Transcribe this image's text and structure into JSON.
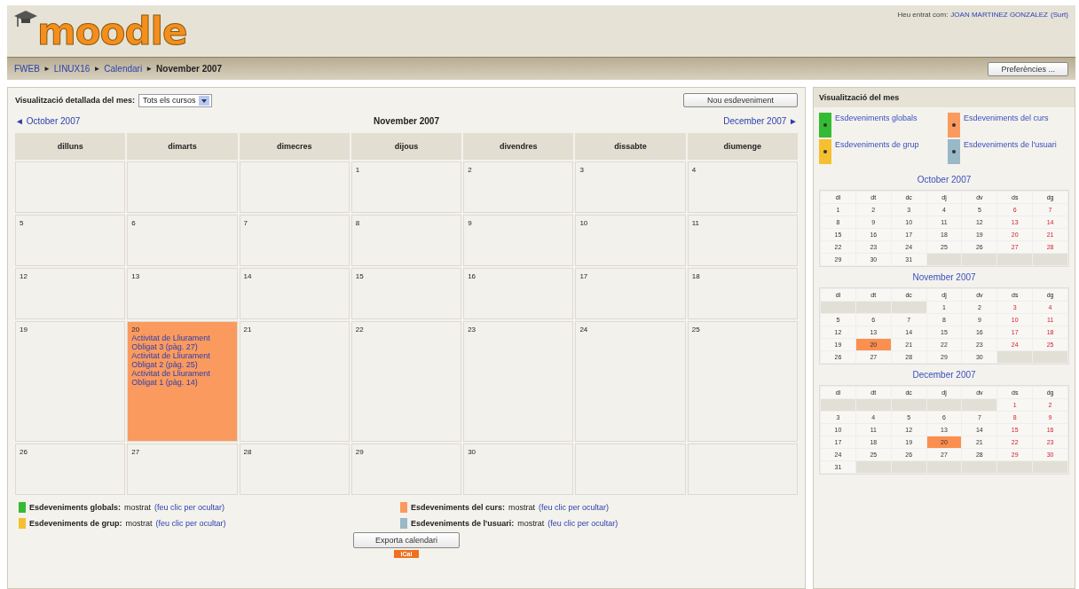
{
  "header": {
    "logo": "moodle",
    "login_prefix": "Heu entrat com:",
    "login_user": "JOAN MARTINEZ GONZALEZ",
    "logout": "(Surt)"
  },
  "breadcrumb": [
    {
      "label": "FWEB",
      "link": true
    },
    {
      "prefix": "►",
      "label": "LINUX16",
      "link": true
    },
    {
      "prefix": "►",
      "label": "Calendari",
      "link": true
    },
    {
      "prefix": "►",
      "label": "November 2007",
      "link": false
    }
  ],
  "preferences_button": "Preferències ...",
  "main": {
    "view_label": "Visualització detallada del mes:",
    "course_select": "Tots els cursos",
    "new_event_button": "Nou esdeveniment",
    "prev_month": "◄ October 2007",
    "month_title": "November 2007",
    "next_month": "December 2007 ►",
    "weekdays": [
      "dilluns",
      "dimarts",
      "dimecres",
      "dijous",
      "divendres",
      "dissabte",
      "diumenge"
    ],
    "weeks": [
      [
        {
          "kind": "blank"
        },
        {
          "kind": "blank"
        },
        {
          "kind": "blank"
        },
        {
          "kind": "day",
          "day": "1"
        },
        {
          "kind": "day",
          "day": "2"
        },
        {
          "kind": "day",
          "day": "3"
        },
        {
          "kind": "day",
          "day": "4"
        }
      ],
      [
        {
          "kind": "day",
          "day": "5"
        },
        {
          "kind": "day",
          "day": "6"
        },
        {
          "kind": "day",
          "day": "7"
        },
        {
          "kind": "day",
          "day": "8"
        },
        {
          "kind": "day",
          "day": "9"
        },
        {
          "kind": "day",
          "day": "10"
        },
        {
          "kind": "day",
          "day": "11"
        }
      ],
      [
        {
          "kind": "day",
          "day": "12"
        },
        {
          "kind": "day",
          "day": "13"
        },
        {
          "kind": "day",
          "day": "14"
        },
        {
          "kind": "day",
          "day": "15"
        },
        {
          "kind": "day",
          "day": "16"
        },
        {
          "kind": "day",
          "day": "17"
        },
        {
          "kind": "day",
          "day": "18"
        }
      ],
      [
        {
          "kind": "day",
          "day": "19"
        },
        {
          "kind": "day",
          "day": "20",
          "color": "#fb9a5e",
          "events": [
            "Activitat de Lliurament Obligat 3 (pàg. 27)",
            "Activitat de Lliurament Obligat 2 (pàg. 25)",
            "Activitat de Lliurament Obligat 1 (pàg. 14)"
          ]
        },
        {
          "kind": "day",
          "day": "21"
        },
        {
          "kind": "day",
          "day": "22"
        },
        {
          "kind": "day",
          "day": "23"
        },
        {
          "kind": "day",
          "day": "24"
        },
        {
          "kind": "day",
          "day": "25"
        }
      ],
      [
        {
          "kind": "day",
          "day": "26"
        },
        {
          "kind": "day",
          "day": "27"
        },
        {
          "kind": "day",
          "day": "28"
        },
        {
          "kind": "day",
          "day": "29"
        },
        {
          "kind": "day",
          "day": "30"
        },
        {
          "kind": "blank"
        },
        {
          "kind": "blank"
        }
      ]
    ],
    "legend": [
      {
        "label": "Esdeveniments globals:",
        "status": "mostrat",
        "action": "(feu clic per ocultar)",
        "color": "#33bb33"
      },
      {
        "label": "Esdeveniments del curs:",
        "status": "mostrat",
        "action": "(feu clic per ocultar)",
        "color": "#fb9a5e"
      },
      {
        "label": "Esdeveniments de grup:",
        "status": "mostrat",
        "action": "(feu clic per ocultar)",
        "color": "#f5c030"
      },
      {
        "label": "Esdeveniments de l'usuari:",
        "status": "mostrat",
        "action": "(feu clic per ocultar)",
        "color": "#99b8c8"
      }
    ],
    "export_button": "Exporta calendari",
    "ical_badge": "iCal"
  },
  "sidebar": {
    "title": "Visualització del mes",
    "legend": [
      {
        "label": "Esdeveniments globals",
        "color": "#33bb33"
      },
      {
        "label": "Esdeveniments del curs",
        "color": "#fb9a5e"
      },
      {
        "label": "Esdeveniments de grup",
        "color": "#f5c030"
      },
      {
        "label": "Esdeveniments de l'usuari",
        "color": "#99b8c8"
      }
    ],
    "months": [
      {
        "title": "October 2007",
        "weekdays": [
          "dl",
          "dt",
          "dc",
          "dj",
          "dv",
          "ds",
          "dg"
        ],
        "weeks": [
          [
            {
              "kind": "day",
              "d": "1",
              "event": false
            },
            {
              "kind": "day",
              "d": "2",
              "event": false
            },
            {
              "kind": "day",
              "d": "3",
              "event": false
            },
            {
              "kind": "day",
              "d": "4",
              "event": false
            },
            {
              "kind": "day",
              "d": "5",
              "event": false
            },
            {
              "kind": "day",
              "d": "6",
              "event": false
            },
            {
              "kind": "day",
              "d": "7",
              "event": false
            }
          ],
          [
            {
              "kind": "day",
              "d": "8",
              "event": false
            },
            {
              "kind": "day",
              "d": "9",
              "event": false
            },
            {
              "kind": "day",
              "d": "10",
              "event": false
            },
            {
              "kind": "day",
              "d": "11",
              "event": false
            },
            {
              "kind": "day",
              "d": "12",
              "event": false
            },
            {
              "kind": "day",
              "d": "13",
              "event": false
            },
            {
              "kind": "day",
              "d": "14",
              "event": false
            }
          ],
          [
            {
              "kind": "day",
              "d": "15",
              "event": false
            },
            {
              "kind": "day",
              "d": "16",
              "event": false
            },
            {
              "kind": "day",
              "d": "17",
              "event": false
            },
            {
              "kind": "day",
              "d": "18",
              "event": false
            },
            {
              "kind": "day",
              "d": "19",
              "event": false
            },
            {
              "kind": "day",
              "d": "20",
              "event": false
            },
            {
              "kind": "day",
              "d": "21",
              "event": false
            }
          ],
          [
            {
              "kind": "day",
              "d": "22",
              "event": false
            },
            {
              "kind": "day",
              "d": "23",
              "event": false
            },
            {
              "kind": "day",
              "d": "24",
              "event": false
            },
            {
              "kind": "day",
              "d": "25",
              "event": false
            },
            {
              "kind": "day",
              "d": "26",
              "event": false
            },
            {
              "kind": "day",
              "d": "27",
              "event": false
            },
            {
              "kind": "day",
              "d": "28",
              "event": false
            }
          ],
          [
            {
              "kind": "day",
              "d": "29",
              "event": false
            },
            {
              "kind": "day",
              "d": "30",
              "event": false
            },
            {
              "kind": "day",
              "d": "31",
              "event": false
            },
            {
              "kind": "blank"
            },
            {
              "kind": "blank"
            },
            {
              "kind": "blank"
            },
            {
              "kind": "blank"
            }
          ]
        ]
      },
      {
        "title": "November 2007",
        "weekdays": [
          "dl",
          "dt",
          "dc",
          "dj",
          "dv",
          "ds",
          "dg"
        ],
        "weeks": [
          [
            {
              "kind": "blank"
            },
            {
              "kind": "blank"
            },
            {
              "kind": "blank"
            },
            {
              "kind": "day",
              "d": "1",
              "event": false
            },
            {
              "kind": "day",
              "d": "2",
              "event": false
            },
            {
              "kind": "day",
              "d": "3",
              "event": false
            },
            {
              "kind": "day",
              "d": "4",
              "event": false
            }
          ],
          [
            {
              "kind": "day",
              "d": "5",
              "event": false
            },
            {
              "kind": "day",
              "d": "6",
              "event": false
            },
            {
              "kind": "day",
              "d": "7",
              "event": false
            },
            {
              "kind": "day",
              "d": "8",
              "event": false
            },
            {
              "kind": "day",
              "d": "9",
              "event": false
            },
            {
              "kind": "day",
              "d": "10",
              "event": false
            },
            {
              "kind": "day",
              "d": "11",
              "event": false
            }
          ],
          [
            {
              "kind": "day",
              "d": "12",
              "event": false
            },
            {
              "kind": "day",
              "d": "13",
              "event": false
            },
            {
              "kind": "day",
              "d": "14",
              "event": false
            },
            {
              "kind": "day",
              "d": "15",
              "event": false
            },
            {
              "kind": "day",
              "d": "16",
              "event": false
            },
            {
              "kind": "day",
              "d": "17",
              "event": false
            },
            {
              "kind": "day",
              "d": "18",
              "event": false
            }
          ],
          [
            {
              "kind": "day",
              "d": "19",
              "event": false
            },
            {
              "kind": "day",
              "d": "20",
              "event": true
            },
            {
              "kind": "day",
              "d": "21",
              "event": false
            },
            {
              "kind": "day",
              "d": "22",
              "event": false
            },
            {
              "kind": "day",
              "d": "23",
              "event": false
            },
            {
              "kind": "day",
              "d": "24",
              "event": false
            },
            {
              "kind": "day",
              "d": "25",
              "event": false
            }
          ],
          [
            {
              "kind": "day",
              "d": "26",
              "event": false
            },
            {
              "kind": "day",
              "d": "27",
              "event": false
            },
            {
              "kind": "day",
              "d": "28",
              "event": false
            },
            {
              "kind": "day",
              "d": "29",
              "event": false
            },
            {
              "kind": "day",
              "d": "30",
              "event": false
            },
            {
              "kind": "blank"
            },
            {
              "kind": "blank"
            }
          ]
        ]
      },
      {
        "title": "December 2007",
        "weekdays": [
          "dl",
          "dt",
          "dc",
          "dj",
          "dv",
          "ds",
          "dg"
        ],
        "weeks": [
          [
            {
              "kind": "blank"
            },
            {
              "kind": "blank"
            },
            {
              "kind": "blank"
            },
            {
              "kind": "blank"
            },
            {
              "kind": "blank"
            },
            {
              "kind": "day",
              "d": "1",
              "event": false
            },
            {
              "kind": "day",
              "d": "2",
              "event": false
            }
          ],
          [
            {
              "kind": "day",
              "d": "3",
              "event": false
            },
            {
              "kind": "day",
              "d": "4",
              "event": false
            },
            {
              "kind": "day",
              "d": "5",
              "event": false
            },
            {
              "kind": "day",
              "d": "6",
              "event": false
            },
            {
              "kind": "day",
              "d": "7",
              "event": false
            },
            {
              "kind": "day",
              "d": "8",
              "event": false
            },
            {
              "kind": "day",
              "d": "9",
              "event": false
            }
          ],
          [
            {
              "kind": "day",
              "d": "10",
              "event": false
            },
            {
              "kind": "day",
              "d": "11",
              "event": false
            },
            {
              "kind": "day",
              "d": "12",
              "event": false
            },
            {
              "kind": "day",
              "d": "13",
              "event": false
            },
            {
              "kind": "day",
              "d": "14",
              "event": false
            },
            {
              "kind": "day",
              "d": "15",
              "event": false
            },
            {
              "kind": "day",
              "d": "16",
              "event": false
            }
          ],
          [
            {
              "kind": "day",
              "d": "17",
              "event": false
            },
            {
              "kind": "day",
              "d": "18",
              "event": false
            },
            {
              "kind": "day",
              "d": "19",
              "event": false
            },
            {
              "kind": "day",
              "d": "20",
              "event": true
            },
            {
              "kind": "day",
              "d": "21",
              "event": false
            },
            {
              "kind": "day",
              "d": "22",
              "event": false
            },
            {
              "kind": "day",
              "d": "23",
              "event": false
            }
          ],
          [
            {
              "kind": "day",
              "d": "24",
              "event": false
            },
            {
              "kind": "day",
              "d": "25",
              "event": false
            },
            {
              "kind": "day",
              "d": "26",
              "event": false
            },
            {
              "kind": "day",
              "d": "27",
              "event": false
            },
            {
              "kind": "day",
              "d": "28",
              "event": false
            },
            {
              "kind": "day",
              "d": "29",
              "event": false
            },
            {
              "kind": "day",
              "d": "30",
              "event": false
            }
          ],
          [
            {
              "kind": "day",
              "d": "31",
              "event": false
            },
            {
              "kind": "blank"
            },
            {
              "kind": "blank"
            },
            {
              "kind": "blank"
            },
            {
              "kind": "blank"
            },
            {
              "kind": "blank"
            },
            {
              "kind": "blank"
            }
          ]
        ]
      }
    ]
  }
}
